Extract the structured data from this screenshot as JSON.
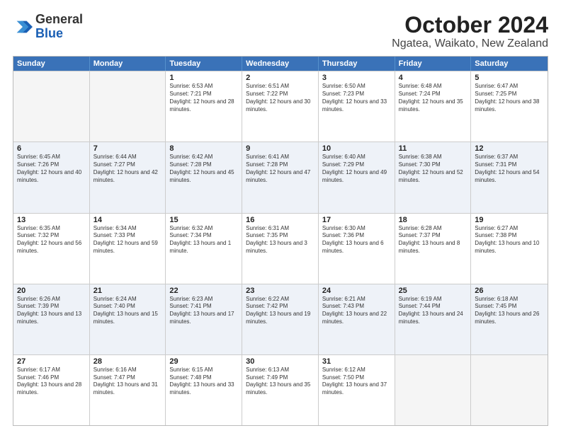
{
  "header": {
    "logo_general": "General",
    "logo_blue": "Blue",
    "title": "October 2024",
    "subtitle": "Ngatea, Waikato, New Zealand"
  },
  "days_of_week": [
    "Sunday",
    "Monday",
    "Tuesday",
    "Wednesday",
    "Thursday",
    "Friday",
    "Saturday"
  ],
  "weeks": [
    [
      {
        "day": "",
        "info": ""
      },
      {
        "day": "",
        "info": ""
      },
      {
        "day": "1",
        "info": "Sunrise: 6:53 AM\nSunset: 7:21 PM\nDaylight: 12 hours and 28 minutes."
      },
      {
        "day": "2",
        "info": "Sunrise: 6:51 AM\nSunset: 7:22 PM\nDaylight: 12 hours and 30 minutes."
      },
      {
        "day": "3",
        "info": "Sunrise: 6:50 AM\nSunset: 7:23 PM\nDaylight: 12 hours and 33 minutes."
      },
      {
        "day": "4",
        "info": "Sunrise: 6:48 AM\nSunset: 7:24 PM\nDaylight: 12 hours and 35 minutes."
      },
      {
        "day": "5",
        "info": "Sunrise: 6:47 AM\nSunset: 7:25 PM\nDaylight: 12 hours and 38 minutes."
      }
    ],
    [
      {
        "day": "6",
        "info": "Sunrise: 6:45 AM\nSunset: 7:26 PM\nDaylight: 12 hours and 40 minutes."
      },
      {
        "day": "7",
        "info": "Sunrise: 6:44 AM\nSunset: 7:27 PM\nDaylight: 12 hours and 42 minutes."
      },
      {
        "day": "8",
        "info": "Sunrise: 6:42 AM\nSunset: 7:28 PM\nDaylight: 12 hours and 45 minutes."
      },
      {
        "day": "9",
        "info": "Sunrise: 6:41 AM\nSunset: 7:28 PM\nDaylight: 12 hours and 47 minutes."
      },
      {
        "day": "10",
        "info": "Sunrise: 6:40 AM\nSunset: 7:29 PM\nDaylight: 12 hours and 49 minutes."
      },
      {
        "day": "11",
        "info": "Sunrise: 6:38 AM\nSunset: 7:30 PM\nDaylight: 12 hours and 52 minutes."
      },
      {
        "day": "12",
        "info": "Sunrise: 6:37 AM\nSunset: 7:31 PM\nDaylight: 12 hours and 54 minutes."
      }
    ],
    [
      {
        "day": "13",
        "info": "Sunrise: 6:35 AM\nSunset: 7:32 PM\nDaylight: 12 hours and 56 minutes."
      },
      {
        "day": "14",
        "info": "Sunrise: 6:34 AM\nSunset: 7:33 PM\nDaylight: 12 hours and 59 minutes."
      },
      {
        "day": "15",
        "info": "Sunrise: 6:32 AM\nSunset: 7:34 PM\nDaylight: 13 hours and 1 minute."
      },
      {
        "day": "16",
        "info": "Sunrise: 6:31 AM\nSunset: 7:35 PM\nDaylight: 13 hours and 3 minutes."
      },
      {
        "day": "17",
        "info": "Sunrise: 6:30 AM\nSunset: 7:36 PM\nDaylight: 13 hours and 6 minutes."
      },
      {
        "day": "18",
        "info": "Sunrise: 6:28 AM\nSunset: 7:37 PM\nDaylight: 13 hours and 8 minutes."
      },
      {
        "day": "19",
        "info": "Sunrise: 6:27 AM\nSunset: 7:38 PM\nDaylight: 13 hours and 10 minutes."
      }
    ],
    [
      {
        "day": "20",
        "info": "Sunrise: 6:26 AM\nSunset: 7:39 PM\nDaylight: 13 hours and 13 minutes."
      },
      {
        "day": "21",
        "info": "Sunrise: 6:24 AM\nSunset: 7:40 PM\nDaylight: 13 hours and 15 minutes."
      },
      {
        "day": "22",
        "info": "Sunrise: 6:23 AM\nSunset: 7:41 PM\nDaylight: 13 hours and 17 minutes."
      },
      {
        "day": "23",
        "info": "Sunrise: 6:22 AM\nSunset: 7:42 PM\nDaylight: 13 hours and 19 minutes."
      },
      {
        "day": "24",
        "info": "Sunrise: 6:21 AM\nSunset: 7:43 PM\nDaylight: 13 hours and 22 minutes."
      },
      {
        "day": "25",
        "info": "Sunrise: 6:19 AM\nSunset: 7:44 PM\nDaylight: 13 hours and 24 minutes."
      },
      {
        "day": "26",
        "info": "Sunrise: 6:18 AM\nSunset: 7:45 PM\nDaylight: 13 hours and 26 minutes."
      }
    ],
    [
      {
        "day": "27",
        "info": "Sunrise: 6:17 AM\nSunset: 7:46 PM\nDaylight: 13 hours and 28 minutes."
      },
      {
        "day": "28",
        "info": "Sunrise: 6:16 AM\nSunset: 7:47 PM\nDaylight: 13 hours and 31 minutes."
      },
      {
        "day": "29",
        "info": "Sunrise: 6:15 AM\nSunset: 7:48 PM\nDaylight: 13 hours and 33 minutes."
      },
      {
        "day": "30",
        "info": "Sunrise: 6:13 AM\nSunset: 7:49 PM\nDaylight: 13 hours and 35 minutes."
      },
      {
        "day": "31",
        "info": "Sunrise: 6:12 AM\nSunset: 7:50 PM\nDaylight: 13 hours and 37 minutes."
      },
      {
        "day": "",
        "info": ""
      },
      {
        "day": "",
        "info": ""
      }
    ]
  ]
}
